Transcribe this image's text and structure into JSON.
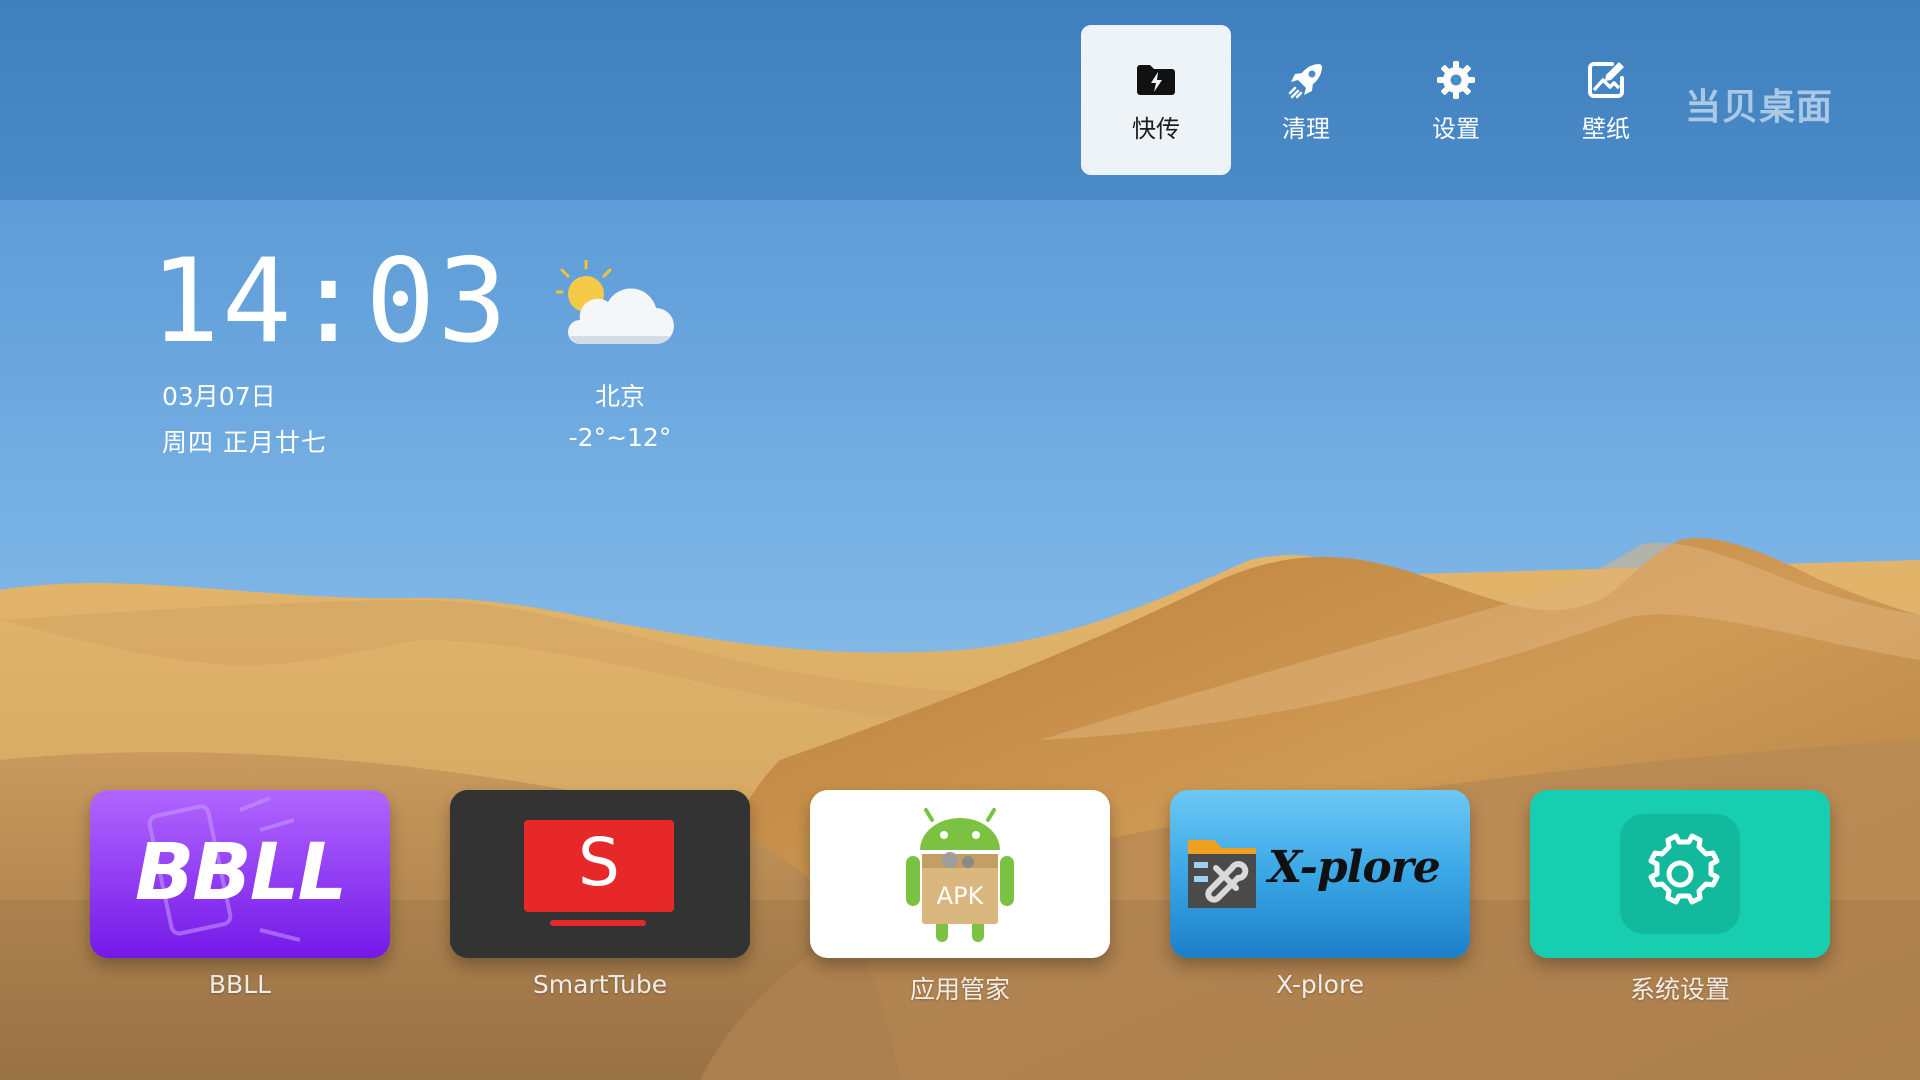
{
  "topbar": {
    "actions": [
      {
        "label": "快传",
        "icon": "quick-transfer-icon",
        "selected": true
      },
      {
        "label": "清理",
        "icon": "rocket-clean-icon",
        "selected": false
      },
      {
        "label": "设置",
        "icon": "gear-icon",
        "selected": false
      },
      {
        "label": "壁纸",
        "icon": "wallpaper-edit-icon",
        "selected": false
      }
    ],
    "brand": "当贝桌面"
  },
  "clock": {
    "time": "14:03",
    "date": "03月07日",
    "lunar": "周四  正月廿七"
  },
  "weather": {
    "icon": "partly-cloudy-icon",
    "city": "北京",
    "temp": "-2°~12°"
  },
  "apps": [
    {
      "name": "BBLL",
      "tile_text": "BBLL",
      "icon": "bbll-app-icon"
    },
    {
      "name": "SmartTube",
      "tile_text": "S",
      "icon": "smarttube-app-icon"
    },
    {
      "name": "应用管家",
      "tile_text": "APK",
      "icon": "apk-manager-app-icon"
    },
    {
      "name": "X-plore",
      "tile_text": "X-plore",
      "icon": "xplore-app-icon"
    },
    {
      "name": "系统设置",
      "icon": "system-settings-app-icon"
    }
  ],
  "colors": {
    "topbar": "#4384c2",
    "selected_action_bg": "#eef3f8",
    "bbll": "#8a2cf0",
    "smarttube_tile": "#333333",
    "smarttube_red": "#e62828",
    "xplore_blue": "#3aa7e6",
    "settings_teal": "#17cfb0"
  }
}
